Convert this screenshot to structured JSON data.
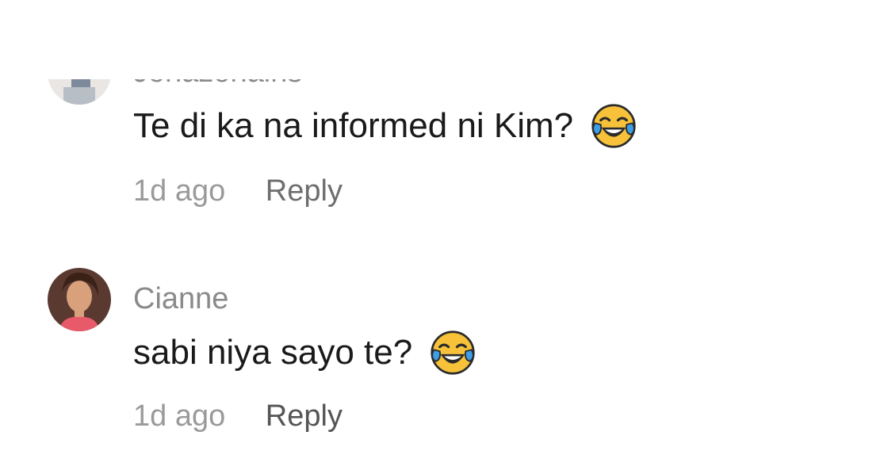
{
  "comments": [
    {
      "username": "Jonazonains",
      "text": "Te di ka na informed ni Kim?",
      "emoji": "face-with-tears-of-joy",
      "time": "1d ago",
      "reply_label": "Reply"
    },
    {
      "username": "Cianne",
      "text": "sabi niya sayo te?",
      "emoji": "face-with-tears-of-joy",
      "time": "1d ago",
      "reply_label": "Reply"
    }
  ],
  "colors": {
    "username": "#8a8a8a",
    "text": "#1a1a1a",
    "time": "#9a9a9a",
    "reply": "#6e6e6e",
    "emoji_face": "#f7c23a",
    "emoji_tear": "#3b9ee6"
  }
}
